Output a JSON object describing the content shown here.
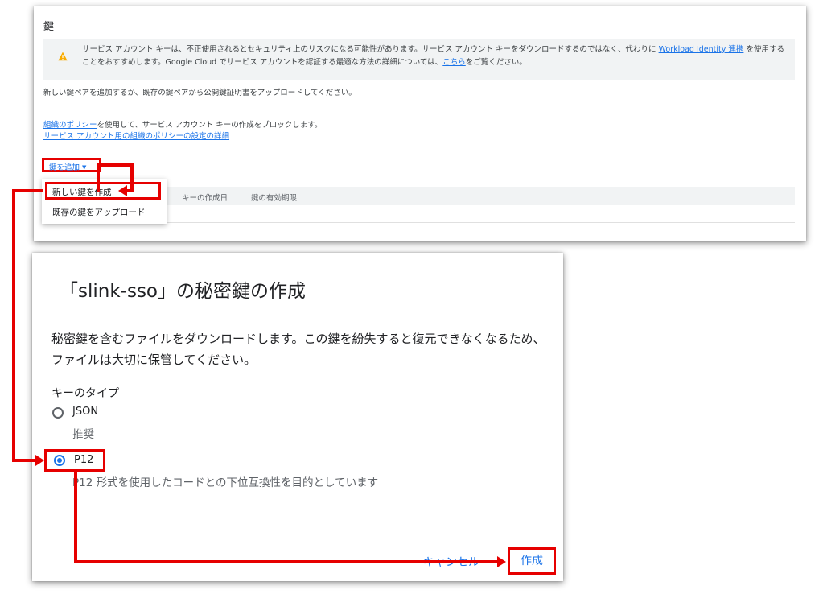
{
  "keys_panel": {
    "title": "鍵",
    "warning": {
      "text_before": "サービス アカウント キーは、不正使用されるとセキュリティ上のリスクになる可能性があります。サービス アカウント キーをダウンロードするのではなく、代わりに",
      "link1": "Workload Identity 連携",
      "text_middle": "を使用することをおすすめします。Google Cloud でサービス アカウントを認証する最適な方法の詳細については、",
      "link2": "こちら",
      "text_after": "をご覧ください。"
    },
    "intro": "新しい鍵ペアを追加するか、既存の鍵ペアから公開鍵証明書をアップロードしてください。",
    "policy": {
      "link": "組織のポリシー",
      "text": "を使用して、サービス アカウント キーの作成をブロックします。",
      "details_link": "サービス アカウント用の組織のポリシーの設定の詳細"
    },
    "add_key_button": "鍵を追加",
    "table_headers": [
      "キーの作成日",
      "鍵の有効期限"
    ],
    "menu_items": [
      "新しい鍵を作成",
      "既存の鍵をアップロード"
    ]
  },
  "dialog": {
    "title": "「slink-sso」の秘密鍵の作成",
    "description": "秘密鍵を含むファイルをダウンロードします。この鍵を紛失すると復元できなくなるため、ファイルは大切に保管してください。",
    "key_type_label": "キーのタイプ",
    "options": [
      {
        "label": "JSON",
        "sub": "推奨",
        "selected": false
      },
      {
        "label": "P12",
        "sub": "P12 形式を使用したコードとの下位互換性を目的としています",
        "selected": true
      }
    ],
    "cancel_button": "キャンセル",
    "create_button": "作成"
  },
  "colors": {
    "highlight": "#e60000",
    "link": "#1a73e8",
    "warning_icon": "#f9ab00"
  }
}
